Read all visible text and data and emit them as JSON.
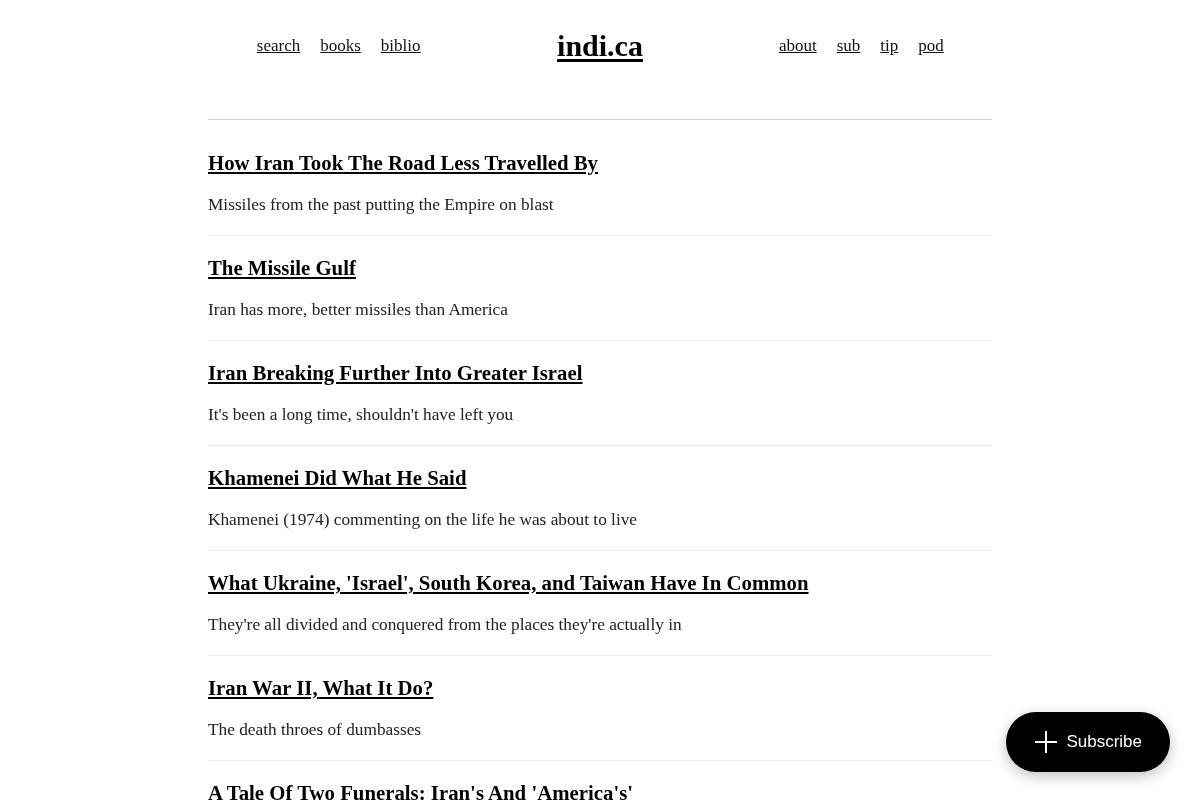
{
  "header": {
    "nav_left": [
      {
        "label": "search"
      },
      {
        "label": "books"
      },
      {
        "label": "biblio"
      }
    ],
    "logo": "indi.ca",
    "nav_right": [
      {
        "label": "about"
      },
      {
        "label": "sub"
      },
      {
        "label": "tip"
      },
      {
        "label": "pod"
      }
    ]
  },
  "posts": [
    {
      "title": "How Iran Took The Road Less Travelled By",
      "subtitle": "Missiles from the past putting the Empire on blast"
    },
    {
      "title": "The Missile Gulf",
      "subtitle": "Iran has more, better missiles than America"
    },
    {
      "title": "Iran Breaking Further Into Greater Israel",
      "subtitle": "It's been a long time, shouldn't have left you"
    },
    {
      "title": "Khamenei Did What He Said",
      "subtitle": "Khamenei (1974) commenting on the life he was about to live"
    },
    {
      "title": "What Ukraine, 'Israel', South Korea, and Taiwan Have In Common",
      "subtitle": "They're all divided and conquered from the places they're actually in"
    },
    {
      "title": "Iran War II, What It Do?",
      "subtitle": "The death throes of dumbasses"
    },
    {
      "title": "A Tale Of Two Funerals: Iran's And 'America's'"
    }
  ],
  "subscribe_button": {
    "label": "Subscribe"
  }
}
